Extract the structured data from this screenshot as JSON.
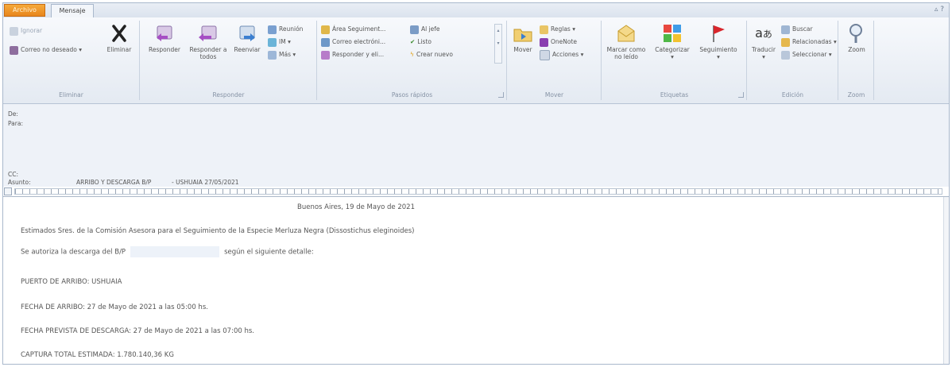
{
  "tabs": {
    "file": "Archivo",
    "message": "Mensaje"
  },
  "ribbon": {
    "eliminar": {
      "ignore": "Ignorar",
      "junk": "Correo no deseado",
      "delete": "Eliminar",
      "label": "Eliminar"
    },
    "responder": {
      "reply": "Responder",
      "reply_all": "Responder a todos",
      "forward": "Reenviar",
      "meeting": "Reunión",
      "im": "IM",
      "more": "Más",
      "label": "Responder"
    },
    "pasos": {
      "items": [
        "Área Seguiment...",
        "Correo electróni...",
        "Responder y eli...",
        "Al jefe",
        "Listo",
        "Crear nuevo"
      ],
      "label": "Pasos rápidos"
    },
    "mover": {
      "move": "Mover",
      "rules": "Reglas",
      "onenote": "OneNote",
      "actions": "Acciones",
      "label": "Mover"
    },
    "etiquetas": {
      "mark_unread": "Marcar como no leído",
      "categorize": "Categorizar",
      "followup": "Seguimiento",
      "label": "Etiquetas"
    },
    "edicion": {
      "translate": "Traducir",
      "find": "Buscar",
      "related": "Relacionadas",
      "select": "Seleccionar",
      "label": "Edición"
    },
    "zoom": {
      "zoom": "Zoom",
      "label": "Zoom"
    }
  },
  "header": {
    "from": "De:",
    "to": "Para:",
    "cc": "CC:",
    "subject_label": "Asunto:",
    "subject_part1": "ARRIBO Y DESCARGA B/P",
    "subject_part2": "- USHUAIA 27/05/2021"
  },
  "body": {
    "date_line": "Buenos Aires, 19 de Mayo de 2021",
    "greeting": "Estimados Sres. de la Comisión Asesora para el Seguimiento de la Especie Merluza Negra (Dissostichus eleginoides)",
    "auth_pre": "Se autoriza la descarga del B/P",
    "auth_post": "según el siguiente detalle:",
    "port": "PUERTO DE ARRIBO: USHUAIA",
    "arrival": "FECHA DE ARRIBO: 27 de Mayo de 2021  a las 05:00 hs.",
    "unload": "FECHA PREVISTA DE DESCARGA: 27 de Mayo de 2021 a las 07:00 hs.",
    "catch": "CAPTURA TOTAL ESTIMADA: 1.780.140,36 KG"
  },
  "colors": {
    "file_tab": "#e7861d",
    "ribbon_bg": "#e4eaf2",
    "header_bg": "#eef2f8"
  }
}
